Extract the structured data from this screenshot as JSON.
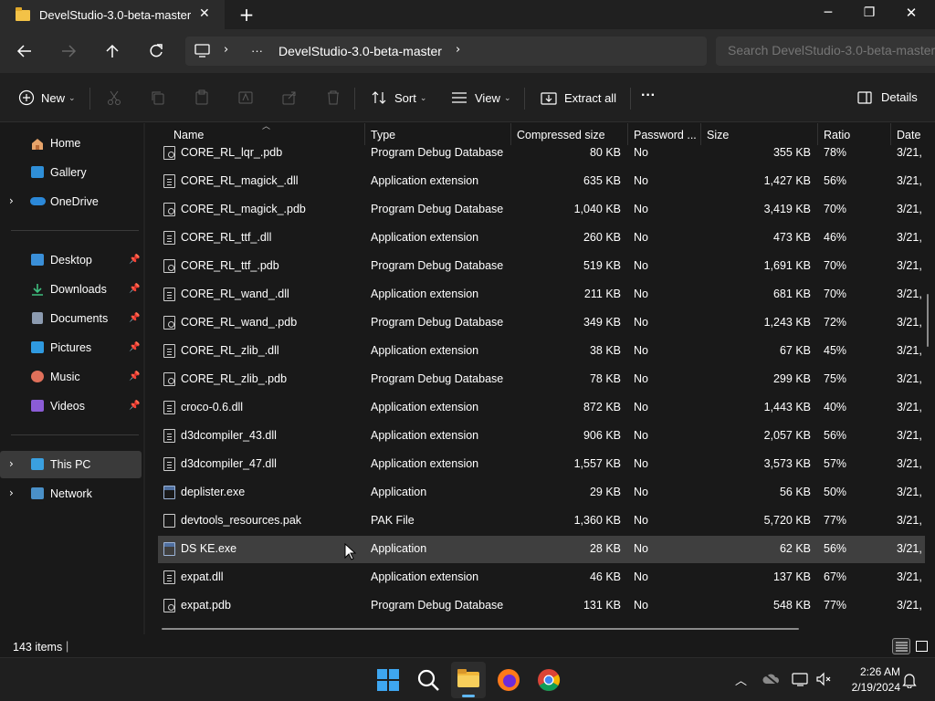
{
  "window": {
    "tab_title": "DevelStudio-3.0-beta-master",
    "new_tab": "+",
    "minimize": "─",
    "maximize": "❐",
    "close": "✕"
  },
  "address": {
    "breadcrumb_more": "···",
    "breadcrumb": "DevelStudio-3.0-beta-master",
    "search_placeholder": "Search DevelStudio-3.0-beta-master"
  },
  "toolbar": {
    "new_label": "New",
    "sort_label": "Sort",
    "view_label": "View",
    "extract_label": "Extract all",
    "more": "···",
    "details_label": "Details"
  },
  "nav": {
    "home": "Home",
    "gallery": "Gallery",
    "onedrive": "OneDrive",
    "desktop": "Desktop",
    "downloads": "Downloads",
    "documents": "Documents",
    "pictures": "Pictures",
    "music": "Music",
    "videos": "Videos",
    "thispc": "This PC",
    "network": "Network"
  },
  "columns": {
    "name": "Name",
    "type": "Type",
    "compressed": "Compressed size",
    "password": "Password ...",
    "size": "Size",
    "ratio": "Ratio",
    "date": "Date"
  },
  "files": [
    {
      "name": "CORE_RL_lqr_.pdb",
      "type": "Program Debug Database",
      "compressed": "80 KB",
      "password": "No",
      "size": "355 KB",
      "ratio": "78%",
      "date": "3/21,",
      "icon": "pdb"
    },
    {
      "name": "CORE_RL_magick_.dll",
      "type": "Application extension",
      "compressed": "635 KB",
      "password": "No",
      "size": "1,427 KB",
      "ratio": "56%",
      "date": "3/21,",
      "icon": "dll"
    },
    {
      "name": "CORE_RL_magick_.pdb",
      "type": "Program Debug Database",
      "compressed": "1,040 KB",
      "password": "No",
      "size": "3,419 KB",
      "ratio": "70%",
      "date": "3/21,",
      "icon": "pdb"
    },
    {
      "name": "CORE_RL_ttf_.dll",
      "type": "Application extension",
      "compressed": "260 KB",
      "password": "No",
      "size": "473 KB",
      "ratio": "46%",
      "date": "3/21,",
      "icon": "dll"
    },
    {
      "name": "CORE_RL_ttf_.pdb",
      "type": "Program Debug Database",
      "compressed": "519 KB",
      "password": "No",
      "size": "1,691 KB",
      "ratio": "70%",
      "date": "3/21,",
      "icon": "pdb"
    },
    {
      "name": "CORE_RL_wand_.dll",
      "type": "Application extension",
      "compressed": "211 KB",
      "password": "No",
      "size": "681 KB",
      "ratio": "70%",
      "date": "3/21,",
      "icon": "dll"
    },
    {
      "name": "CORE_RL_wand_.pdb",
      "type": "Program Debug Database",
      "compressed": "349 KB",
      "password": "No",
      "size": "1,243 KB",
      "ratio": "72%",
      "date": "3/21,",
      "icon": "pdb"
    },
    {
      "name": "CORE_RL_zlib_.dll",
      "type": "Application extension",
      "compressed": "38 KB",
      "password": "No",
      "size": "67 KB",
      "ratio": "45%",
      "date": "3/21,",
      "icon": "dll"
    },
    {
      "name": "CORE_RL_zlib_.pdb",
      "type": "Program Debug Database",
      "compressed": "78 KB",
      "password": "No",
      "size": "299 KB",
      "ratio": "75%",
      "date": "3/21,",
      "icon": "pdb"
    },
    {
      "name": "croco-0.6.dll",
      "type": "Application extension",
      "compressed": "872 KB",
      "password": "No",
      "size": "1,443 KB",
      "ratio": "40%",
      "date": "3/21,",
      "icon": "dll"
    },
    {
      "name": "d3dcompiler_43.dll",
      "type": "Application extension",
      "compressed": "906 KB",
      "password": "No",
      "size": "2,057 KB",
      "ratio": "56%",
      "date": "3/21,",
      "icon": "dll"
    },
    {
      "name": "d3dcompiler_47.dll",
      "type": "Application extension",
      "compressed": "1,557 KB",
      "password": "No",
      "size": "3,573 KB",
      "ratio": "57%",
      "date": "3/21,",
      "icon": "dll"
    },
    {
      "name": "deplister.exe",
      "type": "Application",
      "compressed": "29 KB",
      "password": "No",
      "size": "56 KB",
      "ratio": "50%",
      "date": "3/21,",
      "icon": "exe"
    },
    {
      "name": "devtools_resources.pak",
      "type": "PAK File",
      "compressed": "1,360 KB",
      "password": "No",
      "size": "5,720 KB",
      "ratio": "77%",
      "date": "3/21,",
      "icon": "file"
    },
    {
      "name": "DS KE.exe",
      "type": "Application",
      "compressed": "28 KB",
      "password": "No",
      "size": "62 KB",
      "ratio": "56%",
      "date": "3/21,",
      "icon": "exe",
      "selected": true
    },
    {
      "name": "expat.dll",
      "type": "Application extension",
      "compressed": "46 KB",
      "password": "No",
      "size": "137 KB",
      "ratio": "67%",
      "date": "3/21,",
      "icon": "dll"
    },
    {
      "name": "expat.pdb",
      "type": "Program Debug Database",
      "compressed": "131 KB",
      "password": "No",
      "size": "548 KB",
      "ratio": "77%",
      "date": "3/21,",
      "icon": "pdb"
    }
  ],
  "status": {
    "items": "143 items",
    "sep": "|"
  },
  "taskbar": {
    "time": "2:26 AM",
    "date": "2/19/2024"
  }
}
